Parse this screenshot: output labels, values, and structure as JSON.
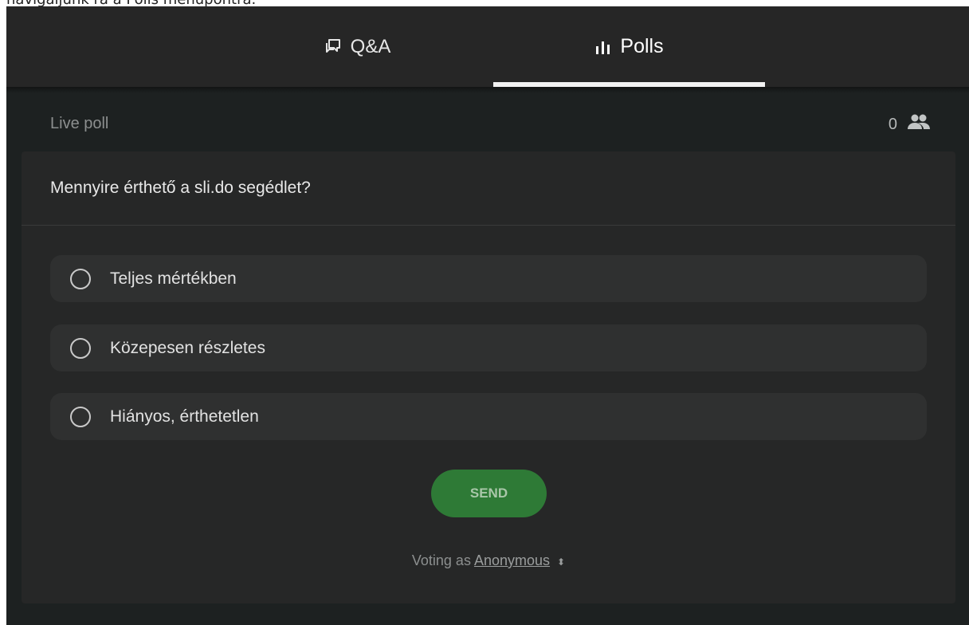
{
  "caption": "navigáljunk rá a Polls menüpontra.",
  "tabs": {
    "qa": "Q&A",
    "polls": "Polls"
  },
  "poll": {
    "status_label": "Live poll",
    "participant_count": "0",
    "question": "Mennyire érthető a sli.do segédlet?",
    "options": [
      "Teljes mértékben",
      "Közepesen részletes",
      "Hiányos, érthetetlen"
    ],
    "send_label": "SEND",
    "voting_prefix": "Voting as",
    "voting_identity": "Anonymous",
    "voting_toggle": "⬍"
  },
  "colors": {
    "topbar": "#262626",
    "background": "#1d2121",
    "card": "#262727",
    "send": "#2e7a36"
  }
}
